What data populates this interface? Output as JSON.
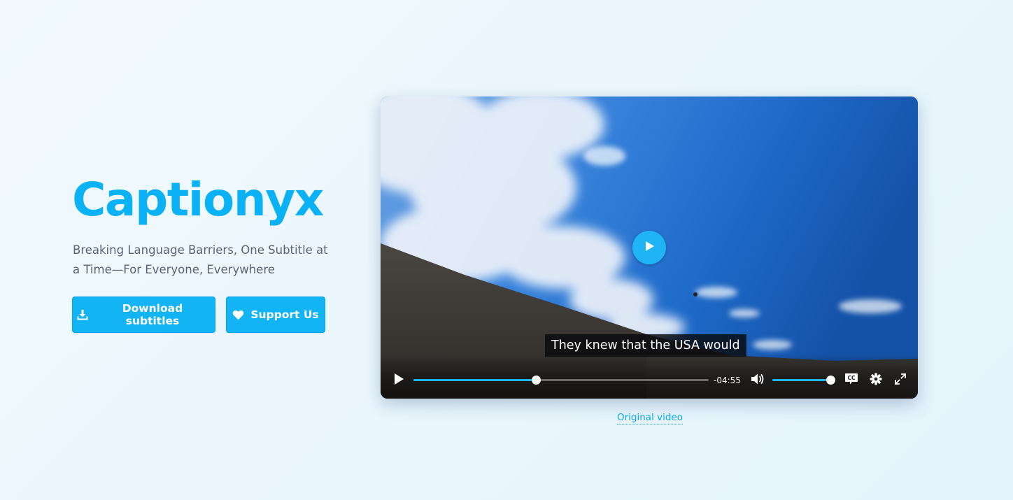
{
  "hero": {
    "title": "Captionyx",
    "tagline": "Breaking Language Barriers, One Subtitle at a Time—For Everyone, Everywhere",
    "buttons": {
      "download_label": "Download subtitles",
      "support_label": "Support Us"
    }
  },
  "player": {
    "caption": "They knew that the USA would",
    "time_remaining": "-04:55",
    "progress_fraction": 0.415,
    "volume_fraction": 0.99,
    "icons": {
      "big_play": "play-icon",
      "play": "play-icon",
      "mute": "volume-icon",
      "captions": "closed-captions-icon",
      "settings": "gear-icon",
      "fullscreen": "fullscreen-icon",
      "download": "download-icon",
      "support": "heart-icon"
    },
    "accent_color": "#1fb4f4"
  },
  "links": {
    "original_video": "Original video"
  },
  "colors": {
    "brand": "#0ab2f5",
    "button_bg": "#12b4f3",
    "text_muted": "#5a6473"
  }
}
